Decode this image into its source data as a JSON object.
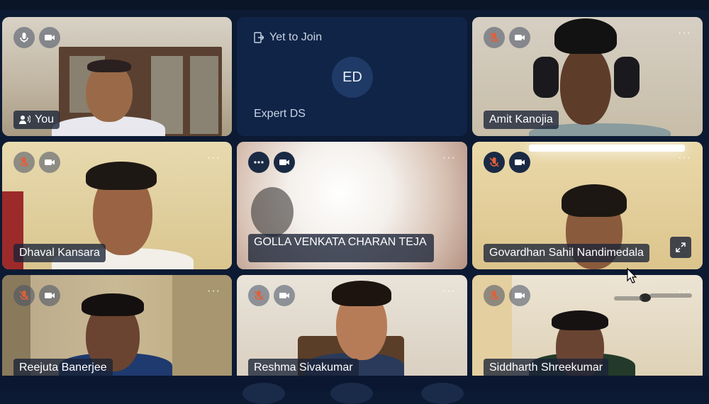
{
  "tiles": [
    {
      "name": "You",
      "mic": "mic-on",
      "cam": "cam-on"
    },
    {
      "status": "Yet to Join",
      "initials": "ED",
      "name": "Expert DS"
    },
    {
      "name": "Amit Kanojia",
      "mic": "mic-muted",
      "cam": "cam-on"
    },
    {
      "name": "Dhaval Kansara",
      "mic": "mic-muted",
      "cam": "cam-on"
    },
    {
      "name": "GOLLA VENKATA CHARAN TEJA",
      "mic": "more",
      "cam": "cam-on"
    },
    {
      "name": "Govardhan Sahil Nandimedala",
      "mic": "mic-muted",
      "cam": "cam-on"
    },
    {
      "name": "Reejuta Banerjee",
      "mic": "mic-muted",
      "cam": "cam-on"
    },
    {
      "name": "Reshma Sivakumar",
      "mic": "mic-muted",
      "cam": "cam-on"
    },
    {
      "name": "Siddharth Shreekumar",
      "mic": "mic-muted",
      "cam": "cam-on"
    }
  ],
  "more_glyph": "···",
  "colors": {
    "background": "#0c1a33",
    "tile_dark": "#0f2446",
    "muted_mic": "#e0603a"
  }
}
